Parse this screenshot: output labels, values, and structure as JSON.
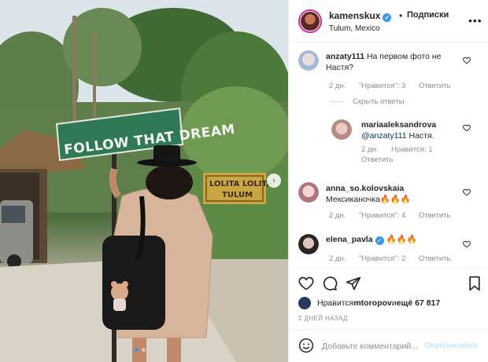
{
  "post": {
    "author": "kamenskux",
    "separator": "•",
    "follow_label": "Подписки",
    "location": "Tulum, Mexico",
    "more_label": "•••"
  },
  "photo": {
    "sign_text": "FOLLOW THAT DREAM",
    "lolita_line1": "LOLITA LOLITA",
    "lolita_line2": "TULUM",
    "slide_index": 1,
    "slide_count": 2
  },
  "comments": [
    {
      "user": "anzaty111",
      "text": "На первом фото не Настя?",
      "time": "2 дн.",
      "likes": "\"Нравится\": 3",
      "reply": "Ответить"
    },
    {
      "hide_replies": "Скрыть ответы"
    },
    {
      "user": "mariaaleksandrova",
      "mention": "@anzaty111",
      "text": " Настя.",
      "time": "2 дн.",
      "likes": "Нравится: 1",
      "reply": "Ответить"
    },
    {
      "user": "anna_so.kolovskaia",
      "text": "Мексиканочка🔥🔥🔥",
      "time": "2 дн.",
      "likes": "\"Нравится\": 4",
      "reply": "Ответить"
    },
    {
      "user": "elena_pavla",
      "text": "🔥🔥🔥",
      "time": "2 дн.",
      "likes": "\"Нравится\": 2",
      "reply": "Ответить"
    }
  ],
  "likes_line": {
    "prefix": "Нравится ",
    "user": "mtoropov",
    "middle": " и ",
    "rest": "ещё 67 817"
  },
  "post_date": "2 ДНЕЙ НАЗАД",
  "add_comment": {
    "placeholder": "Добавьте комментарий...",
    "publish_label": "Опубликовать"
  },
  "colors": {
    "accent": "#3897f0",
    "publish_disabled": "#b2dffc",
    "sign_green": "#2f7a55"
  },
  "icons": [
    "heart-icon",
    "comment-icon",
    "share-icon",
    "bookmark-icon",
    "emoji-icon",
    "verified-icon",
    "more-icon",
    "chevron-right-icon"
  ]
}
